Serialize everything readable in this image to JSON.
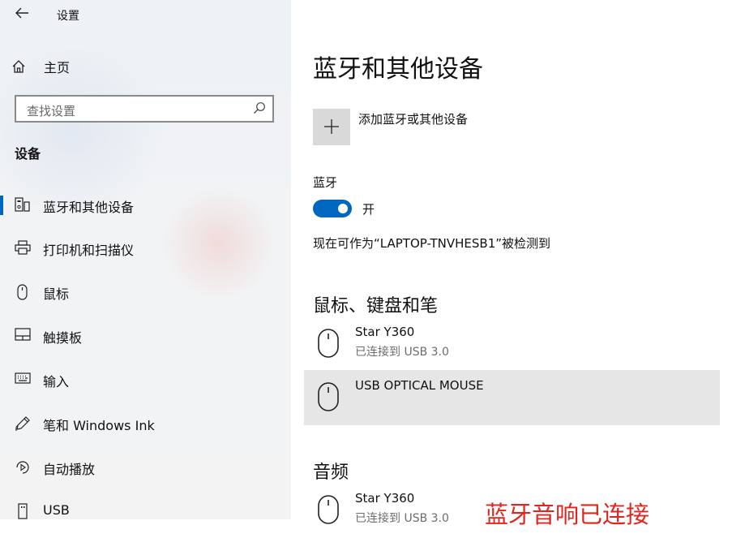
{
  "app": {
    "title": "设置",
    "back_icon": "back-arrow-icon"
  },
  "sidebar": {
    "home_label": "主页",
    "search_placeholder": "查找设置",
    "section_title": "设备",
    "items": [
      {
        "label": "蓝牙和其他设备",
        "icon": "bluetooth-devices-icon",
        "selected": true
      },
      {
        "label": "打印机和扫描仪",
        "icon": "printer-icon"
      },
      {
        "label": "鼠标",
        "icon": "mouse-icon"
      },
      {
        "label": "触摸板",
        "icon": "touchpad-icon"
      },
      {
        "label": "输入",
        "icon": "keyboard-icon"
      },
      {
        "label": "笔和 Windows Ink",
        "icon": "pen-icon"
      },
      {
        "label": "自动播放",
        "icon": "autoplay-icon"
      },
      {
        "label": "USB",
        "icon": "usb-icon"
      }
    ]
  },
  "main": {
    "title": "蓝牙和其他设备",
    "add_device_label": "添加蓝牙或其他设备",
    "bluetooth_label": "蓝牙",
    "bluetooth_state": "开",
    "bluetooth_on": true,
    "discoverable_text": "现在可作为“LAPTOP-TNVHESB1”被检测到",
    "sections": [
      {
        "title": "鼠标、键盘和笔",
        "devices": [
          {
            "name": "Star Y360",
            "status": "已连接到 USB 3.0"
          },
          {
            "name": "USB OPTICAL MOUSE",
            "status": "",
            "selected": true
          }
        ]
      },
      {
        "title": "音频",
        "devices": [
          {
            "name": "Star Y360",
            "status": "已连接到 USB 3.0"
          }
        ]
      }
    ]
  },
  "annotation": {
    "text": "蓝牙音响已连接",
    "color": "#e0261c"
  },
  "colors": {
    "accent": "#0067c0",
    "selected_row": "#e6e6e6"
  }
}
